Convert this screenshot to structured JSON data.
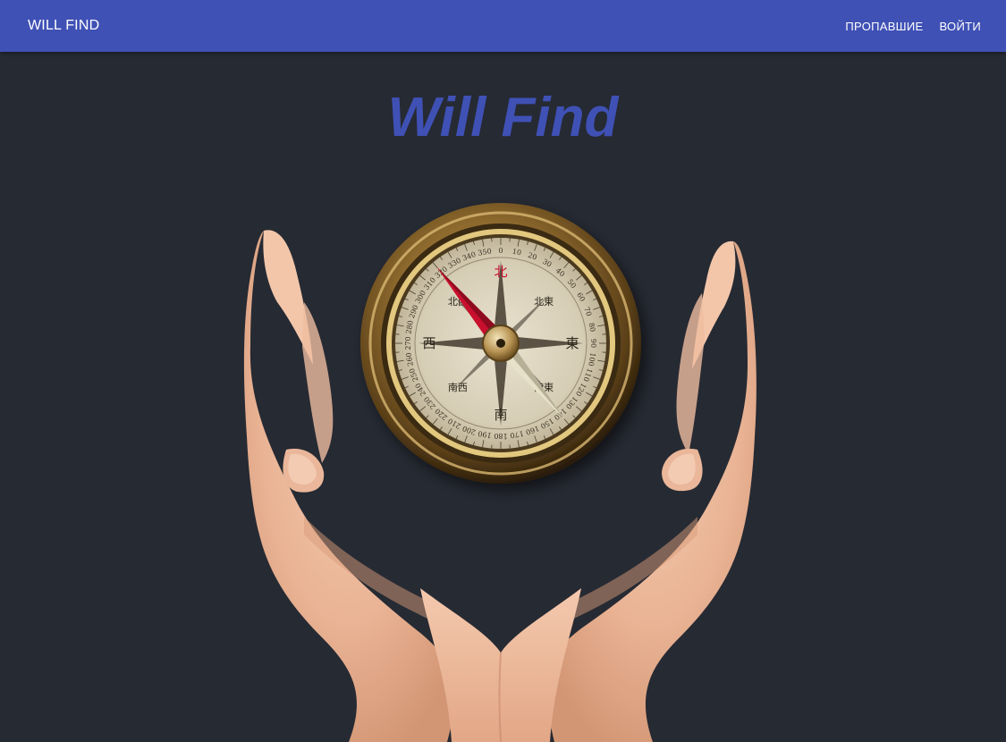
{
  "navbar": {
    "brand": "WILL FIND",
    "links": [
      "ПРОПАВШИЕ",
      "ВОЙТИ"
    ]
  },
  "hero": {
    "title": "Will Find",
    "image_alt": "compass-in-hands"
  },
  "compass": {
    "glyphs": [
      "北",
      "北東",
      "東",
      "南東",
      "南",
      "南西",
      "西",
      "北西"
    ],
    "ticks": [
      "0",
      "10",
      "20",
      "30",
      "40",
      "50",
      "60",
      "70",
      "80",
      "90",
      "100",
      "110",
      "120",
      "130",
      "140",
      "150",
      "160",
      "170",
      "180",
      "190",
      "200",
      "210",
      "220",
      "230",
      "240",
      "250",
      "260",
      "270",
      "280",
      "290",
      "300",
      "310",
      "320",
      "330",
      "340",
      "350"
    ]
  },
  "colors": {
    "appbar": "#3f51b5",
    "background": "#262a33",
    "title": "#3f51b5",
    "nav_text": "#ffffff"
  }
}
